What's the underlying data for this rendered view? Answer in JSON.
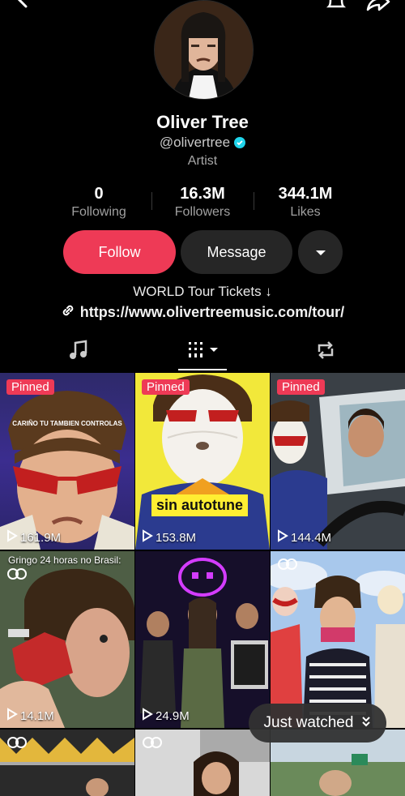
{
  "profile": {
    "name": "Oliver Tree",
    "handle": "@olivertree",
    "role": "Artist"
  },
  "stats": {
    "following": {
      "value": "0",
      "label": "Following"
    },
    "followers": {
      "value": "16.3M",
      "label": "Followers"
    },
    "likes": {
      "value": "344.1M",
      "label": "Likes"
    }
  },
  "actions": {
    "follow_label": "Follow",
    "message_label": "Message"
  },
  "bio": {
    "line": "WORLD Tour Tickets ↓",
    "link": "https://www.olivertreemusic.com/tour/"
  },
  "tabs": [
    "music-icon",
    "grid-icon",
    "repost-icon"
  ],
  "videos": [
    {
      "pinned": "Pinned",
      "views": "161.9M",
      "caption": "CARIÑO TU TAMBIEN CONTROLAS"
    },
    {
      "pinned": "Pinned",
      "views": "153.8M",
      "caption": "sin autotune"
    },
    {
      "pinned": "Pinned",
      "views": "144.4M"
    },
    {
      "views": "14.1M",
      "caption": "Gringo 24 horas no Brasil:"
    },
    {
      "views": "24.9M"
    },
    {
      "views": ""
    }
  ],
  "just_watched": {
    "label": "Just watched"
  },
  "colors": {
    "accent": "#ee3a56",
    "background": "#000000",
    "button_dark": "#262626",
    "verified": "#20d5ec"
  }
}
